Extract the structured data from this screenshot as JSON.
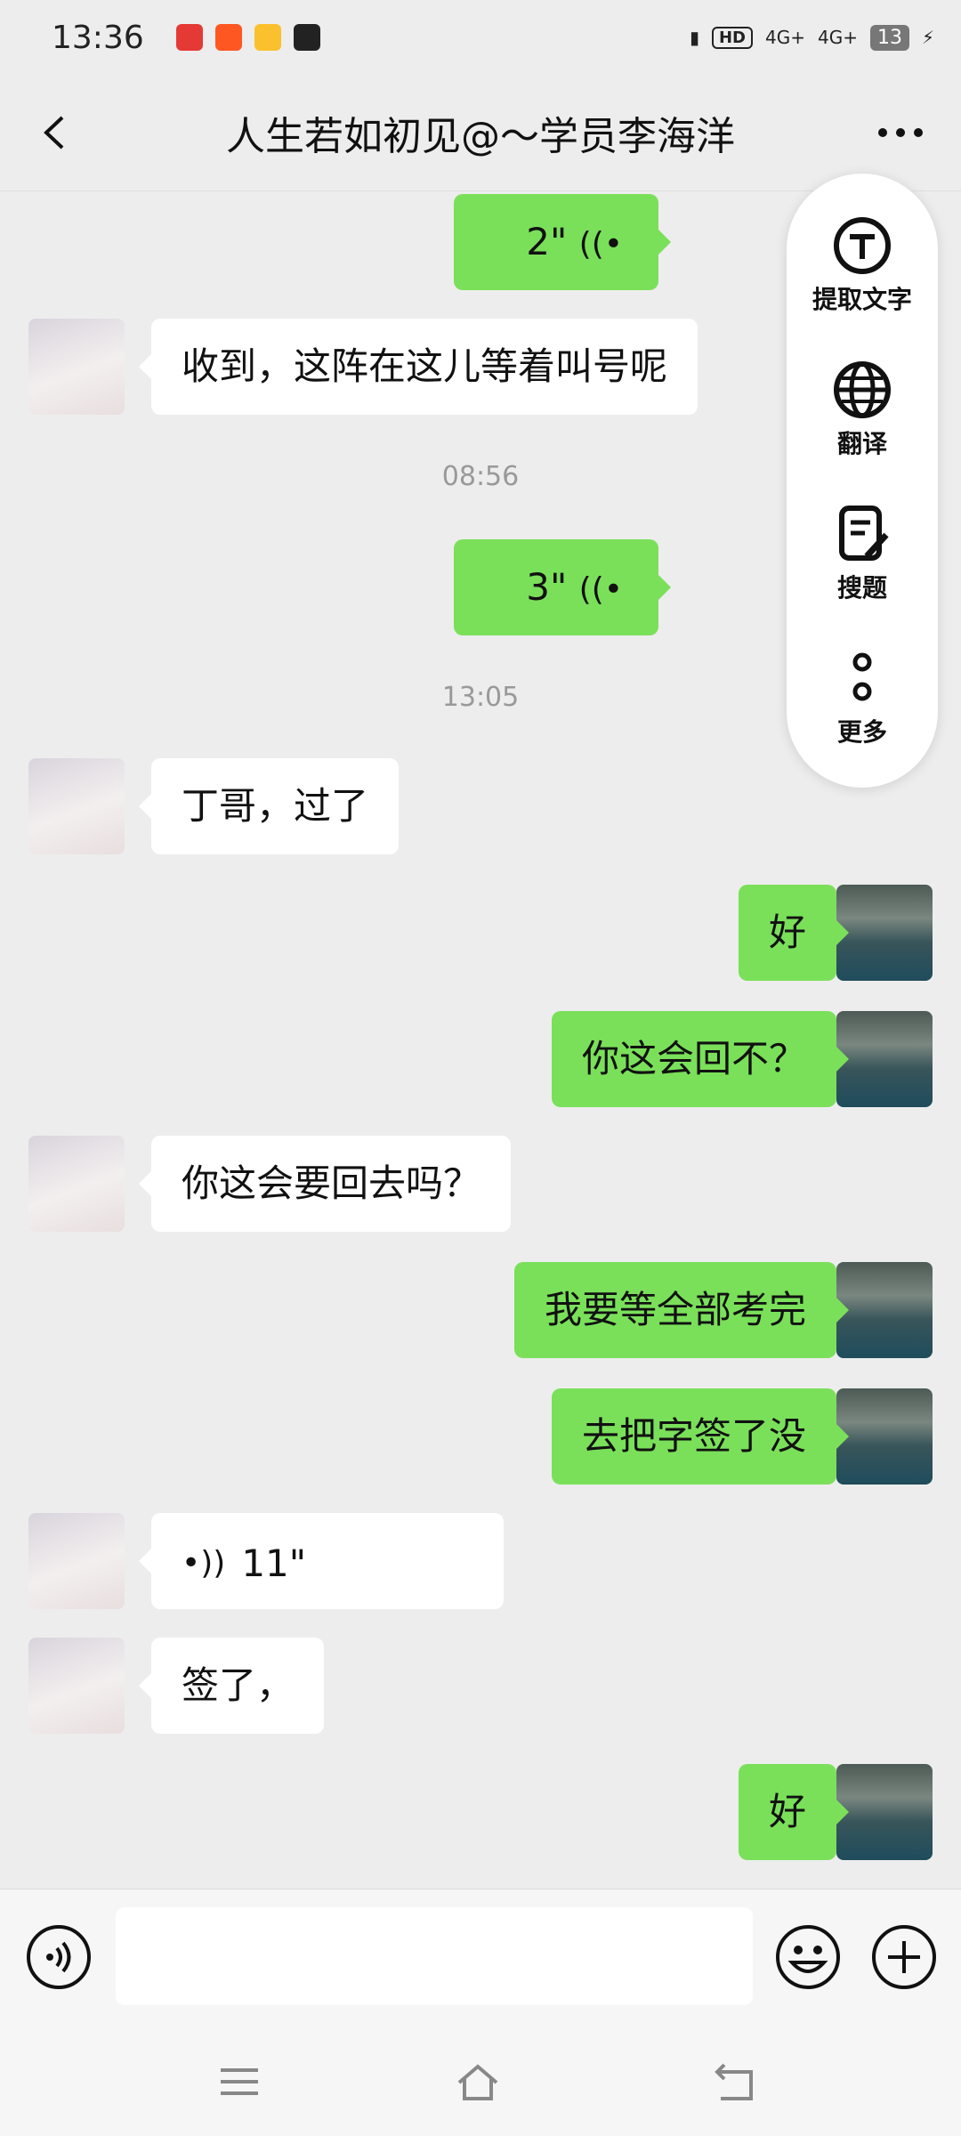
{
  "status_bar": {
    "time": "13:36",
    "hd": "HD",
    "net1": "4G+",
    "net2": "4G+",
    "battery": "13",
    "notification_colors": [
      "#e53935",
      "#ff5722",
      "#fbc02d",
      "#222222"
    ]
  },
  "nav": {
    "title": "人生若如初见@～学员李海洋",
    "back_icon": "chevron-left-icon",
    "more_icon": "ellipsis-icon"
  },
  "messages": [
    {
      "side": "right",
      "type": "voice",
      "duration": "2\""
    },
    {
      "side": "left",
      "type": "text",
      "text": "收到，这阵在这儿等着叫号呢"
    },
    {
      "side": "center",
      "type": "timestamp",
      "text": "08:56"
    },
    {
      "side": "right",
      "type": "voice",
      "duration": "3\""
    },
    {
      "side": "center",
      "type": "timestamp",
      "text": "13:05"
    },
    {
      "side": "left",
      "type": "text",
      "text": "丁哥，过了"
    },
    {
      "side": "right",
      "type": "text",
      "text": "好"
    },
    {
      "side": "right",
      "type": "text",
      "text": "你这会回不？"
    },
    {
      "side": "left",
      "type": "text",
      "text": "你这会要回去吗？"
    },
    {
      "side": "right",
      "type": "text",
      "text": "我要等全部考完"
    },
    {
      "side": "right",
      "type": "text",
      "text": "去把字签了没"
    },
    {
      "side": "left",
      "type": "voice",
      "duration": "11\""
    },
    {
      "side": "left",
      "type": "text",
      "text": "签了，"
    },
    {
      "side": "right",
      "type": "text",
      "text": "好"
    }
  ],
  "popup_menu": [
    {
      "label": "提取文字",
      "icon": "extract-text-icon"
    },
    {
      "label": "翻译",
      "icon": "globe-icon"
    },
    {
      "label": "搜题",
      "icon": "search-question-icon"
    },
    {
      "label": "更多",
      "icon": "more-vertical-icon"
    }
  ],
  "composer": {
    "input_value": "",
    "input_placeholder": "",
    "voice_icon": "voice-icon",
    "emoji_icon": "emoji-icon",
    "plus_icon": "plus-icon"
  },
  "system_nav": [
    "menu-icon",
    "home-icon",
    "back-icon"
  ],
  "colors": {
    "background": "#ededed",
    "sent_bubble": "#7ae05a",
    "received_bubble": "#ffffff",
    "timestamp": "#999999"
  }
}
